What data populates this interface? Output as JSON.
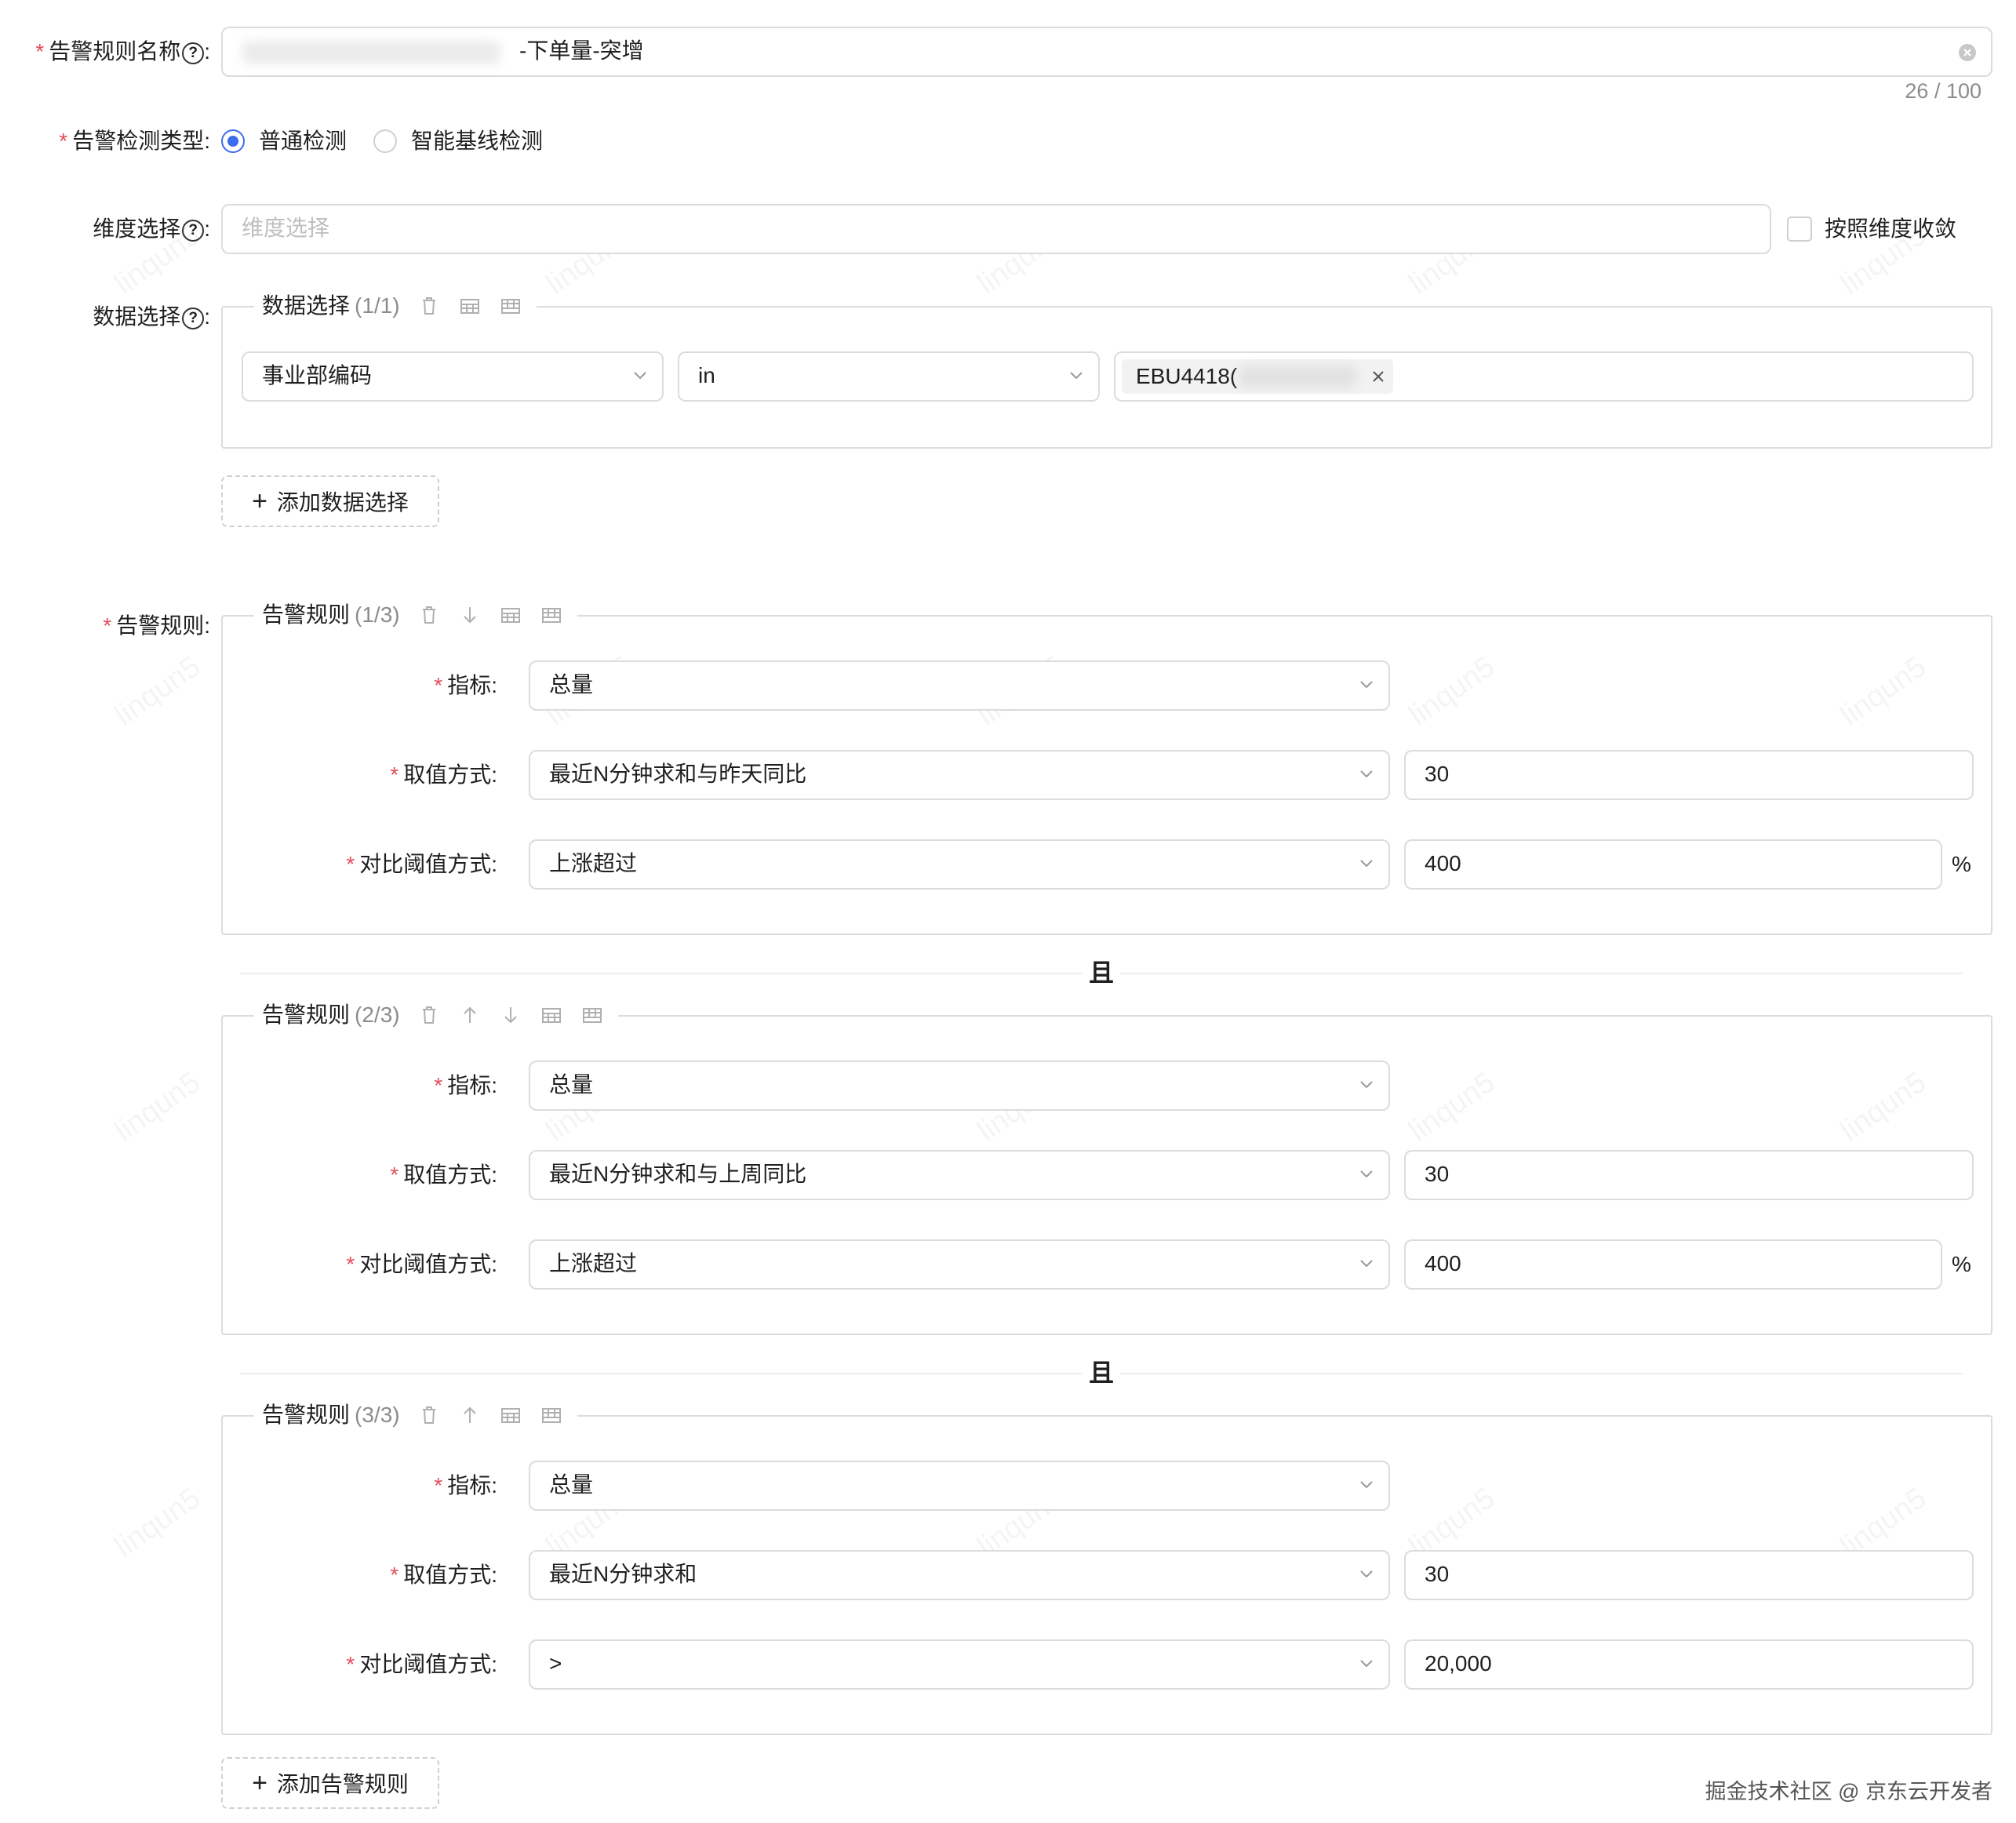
{
  "form": {
    "name": {
      "label": "告警规则名称",
      "value": "-下单量-突增",
      "counter": "26 / 100"
    },
    "detect_type": {
      "label": "告警检测类型",
      "options": [
        "普通检测",
        "智能基线检测"
      ],
      "selected": "普通检测"
    },
    "dimension": {
      "label": "维度选择",
      "placeholder": "维度选择",
      "checkbox_label": "按照维度收敛",
      "checked": false
    },
    "data_select": {
      "label": "数据选择",
      "group_title": "数据选择",
      "group_count": "(1/1)",
      "field": "事业部编码",
      "operator": "in",
      "tag": "EBU4418(",
      "add_button": "添加数据选择"
    },
    "rules": {
      "label": "告警规则",
      "connector": "且",
      "metric_label": "指标",
      "value_mode_label": "取值方式",
      "threshold_label": "对比阈值方式",
      "unit": "%",
      "items": [
        {
          "title": "告警规则",
          "count": "(1/3)",
          "metric": "总量",
          "value_mode": "最近N分钟求和与昨天同比",
          "n": "30",
          "compare": "上涨超过",
          "threshold": "400"
        },
        {
          "title": "告警规则",
          "count": "(2/3)",
          "metric": "总量",
          "value_mode": "最近N分钟求和与上周同比",
          "n": "30",
          "compare": "上涨超过",
          "threshold": "400"
        },
        {
          "title": "告警规则",
          "count": "(3/3)",
          "metric": "总量",
          "value_mode": "最近N分钟求和",
          "n": "30",
          "compare": ">",
          "threshold": "20,000"
        }
      ],
      "add_button": "添加告警规则"
    }
  },
  "watermark": "掘金技术社区 @ 京东云开发者",
  "bg_watermark": "linqun5",
  "colors": {
    "accent": "#3c6df0",
    "required": "#e34d59",
    "border": "#dcdcdc"
  }
}
